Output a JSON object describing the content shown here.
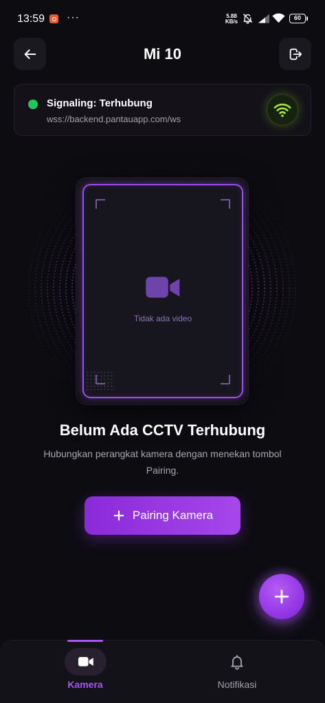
{
  "status_bar": {
    "time": "13:59",
    "more": "···",
    "net_speed": "5.88",
    "net_unit": "KB/s",
    "battery": "60",
    "icons": [
      "app-notification-icon",
      "mute-icon",
      "signal-icon",
      "wifi-icon",
      "battery-icon"
    ]
  },
  "header": {
    "title": "Mi 10",
    "back_icon": "back-arrow-icon",
    "logout_icon": "logout-icon"
  },
  "signaling": {
    "status": "Signaling: Terhubung",
    "url": "wss://backend.pantauapp.com/ws",
    "connected": true,
    "icon": "wifi-icon"
  },
  "preview": {
    "icon": "video-camera-icon",
    "empty_text": "Tidak ada video"
  },
  "empty_state": {
    "title": "Belum Ada CCTV Terhubung",
    "description": "Hubungkan perangkat kamera dengan menekan tombol Pairing."
  },
  "pairing_button": {
    "icon": "plus-icon",
    "label": "Pairing Kamera"
  },
  "fab": {
    "icon": "plus-icon"
  },
  "bottom_nav": {
    "items": [
      {
        "label": "Kamera",
        "icon": "video-camera-icon",
        "active": true
      },
      {
        "label": "Notifikasi",
        "icon": "bell-icon",
        "active": false
      }
    ]
  },
  "colors": {
    "background": "#0d0c11",
    "surface": "#141218",
    "accent": "#a855f7",
    "success": "#22c55e",
    "signal": "#a3e635"
  }
}
